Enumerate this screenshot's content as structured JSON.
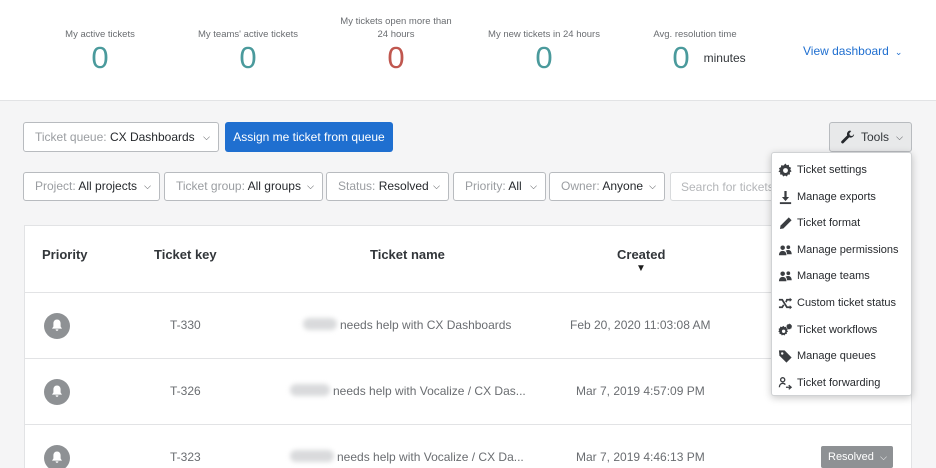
{
  "stats": [
    {
      "label": "My active tickets",
      "value": "0",
      "color": "#4a9a9c"
    },
    {
      "label": "My teams' active tickets",
      "value": "0",
      "color": "#4a9a9c"
    },
    {
      "label": "My tickets open more than 24 hours",
      "value": "0",
      "color": "#c0574f"
    },
    {
      "label": "My new tickets in 24 hours",
      "value": "0",
      "color": "#4a9a9c"
    },
    {
      "label": "Avg. resolution time",
      "value": "0",
      "unit": "minutes",
      "color": "#4a9a9c"
    }
  ],
  "view_dashboard": "View dashboard",
  "queue": {
    "label": "Ticket queue:",
    "value": "CX Dashboards"
  },
  "assign_button": "Assign me ticket from queue",
  "tools_button": "Tools",
  "filters": [
    {
      "label": "Project:",
      "value": "All projects"
    },
    {
      "label": "Ticket group:",
      "value": "All groups"
    },
    {
      "label": "Status:",
      "value": "Resolved"
    },
    {
      "label": "Priority:",
      "value": "All"
    },
    {
      "label": "Owner:",
      "value": "Anyone"
    }
  ],
  "search_placeholder": "Search for tickets",
  "table": {
    "headers": {
      "priority": "Priority",
      "key": "Ticket key",
      "name": "Ticket name",
      "created": "Created"
    },
    "rows": [
      {
        "key": "T-330",
        "name": "needs help with CX Dashboards",
        "created": "Feb 20, 2020 11:03:08 AM",
        "status": ""
      },
      {
        "key": "T-326",
        "name": "needs help with Vocalize / CX Das...",
        "created": "Mar 7, 2019 4:57:09 PM",
        "status": ""
      },
      {
        "key": "T-323",
        "name": "needs help with Vocalize / CX Da...",
        "created": "Mar 7, 2019 4:46:13 PM",
        "status": "Resolved"
      }
    ]
  },
  "tools_menu": [
    {
      "label": "Ticket settings",
      "icon": "gear-icon"
    },
    {
      "label": "Manage exports",
      "icon": "download-icon"
    },
    {
      "label": "Ticket format",
      "icon": "pencil-icon"
    },
    {
      "label": "Manage permissions",
      "icon": "users-icon"
    },
    {
      "label": "Manage teams",
      "icon": "team-icon"
    },
    {
      "label": "Custom ticket status",
      "icon": "shuffle-icon"
    },
    {
      "label": "Ticket workflows",
      "icon": "gears-icon"
    },
    {
      "label": "Manage queues",
      "icon": "tags-icon"
    },
    {
      "label": "Ticket forwarding",
      "icon": "forward-icon"
    }
  ]
}
